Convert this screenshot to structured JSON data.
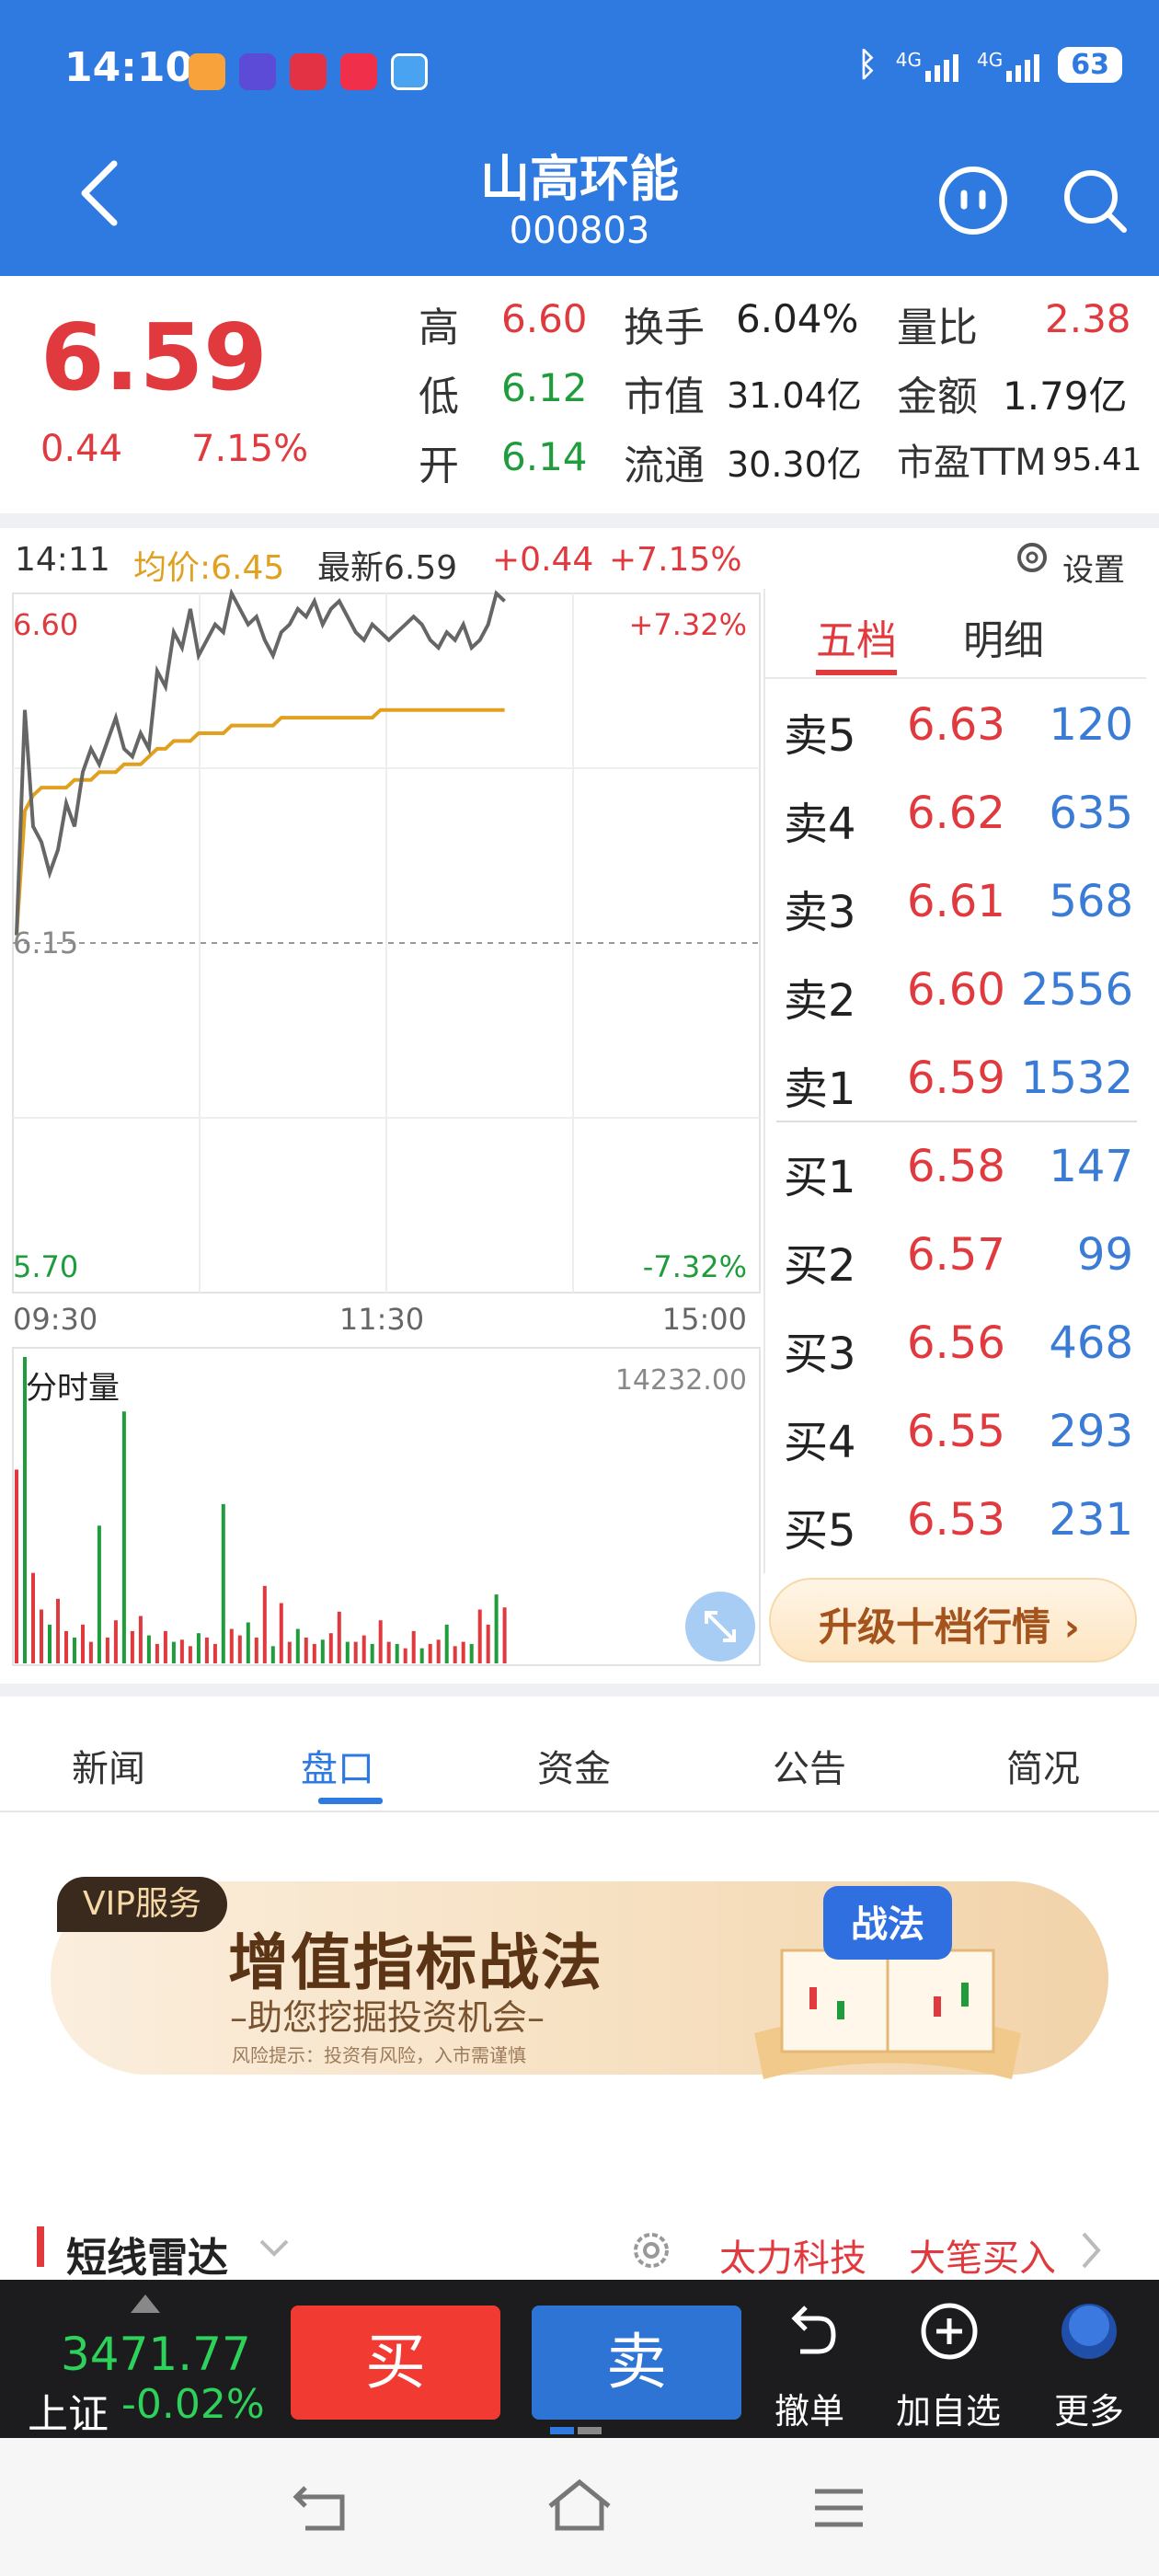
{
  "status_bar": {
    "time": "14:10",
    "network1": "4G",
    "network2": "4G",
    "battery": "63"
  },
  "header": {
    "name": "山高环能",
    "code": "000803"
  },
  "quote": {
    "price": "6.59",
    "change": "0.44",
    "change_pct": "7.15%",
    "high_label": "高",
    "high": "6.60",
    "low_label": "低",
    "low": "6.12",
    "open_label": "开",
    "open": "6.14",
    "turnover_label": "换手",
    "turnover": "6.04%",
    "mktcap_label": "市值",
    "mktcap": "31.04亿",
    "float_label": "流通",
    "float": "30.30亿",
    "volratio_label": "量比",
    "volratio": "2.38",
    "amount_label": "金额",
    "amount": "1.79亿",
    "pe_label": "市盈TTM",
    "pe": "95.41"
  },
  "chart_header": {
    "time": "14:11",
    "avg": "均价:6.45",
    "latest": "最新6.59",
    "chg": "+0.44",
    "pct": "+7.15%",
    "settings": "设置"
  },
  "chart_labels": {
    "top_left": "6.60",
    "top_right": "+7.32%",
    "mid": "6.15",
    "bottom_left": "5.70",
    "bottom_right": "-7.32%",
    "t0": "09:30",
    "t1": "11:30",
    "t2": "15:00",
    "vol_title": "分时量",
    "vol_max": "14232.00"
  },
  "chart_data": {
    "type": "line",
    "ylim": [
      5.7,
      6.6
    ],
    "x_range": [
      "09:30",
      "15:00"
    ],
    "reference": 6.15,
    "series": [
      {
        "name": "price",
        "color": "#666666",
        "values": [
          6.16,
          6.45,
          6.3,
          6.28,
          6.24,
          6.27,
          6.33,
          6.3,
          6.37,
          6.4,
          6.38,
          6.41,
          6.44,
          6.4,
          6.39,
          6.42,
          6.4,
          6.5,
          6.48,
          6.55,
          6.53,
          6.58,
          6.52,
          6.54,
          6.56,
          6.55,
          6.6,
          6.58,
          6.56,
          6.57,
          6.54,
          6.52,
          6.55,
          6.56,
          6.58,
          6.57,
          6.59,
          6.56,
          6.58,
          6.59,
          6.57,
          6.55,
          6.54,
          6.56,
          6.55,
          6.54,
          6.55,
          6.56,
          6.57,
          6.56,
          6.54,
          6.53,
          6.55,
          6.54,
          6.56,
          6.53,
          6.54,
          6.56,
          6.6,
          6.59
        ]
      },
      {
        "name": "avg",
        "color": "#e0a020",
        "values": [
          6.16,
          6.32,
          6.34,
          6.35,
          6.35,
          6.35,
          6.35,
          6.36,
          6.36,
          6.36,
          6.37,
          6.37,
          6.37,
          6.38,
          6.38,
          6.38,
          6.39,
          6.4,
          6.4,
          6.41,
          6.41,
          6.41,
          6.42,
          6.42,
          6.42,
          6.42,
          6.43,
          6.43,
          6.43,
          6.43,
          6.43,
          6.43,
          6.44,
          6.44,
          6.44,
          6.44,
          6.44,
          6.44,
          6.44,
          6.44,
          6.44,
          6.44,
          6.44,
          6.44,
          6.45,
          6.45,
          6.45,
          6.45,
          6.45,
          6.45,
          6.45,
          6.45,
          6.45,
          6.45,
          6.45,
          6.45,
          6.45,
          6.45,
          6.45,
          6.45
        ]
      }
    ],
    "volume_max": 14232.0,
    "volume": [
      9000,
      14232,
      4200,
      2500,
      1800,
      3000,
      1500,
      1200,
      1800,
      1000,
      6400,
      1200,
      2000,
      11700,
      1500,
      2200,
      1300,
      900,
      1500,
      1000,
      1100,
      800,
      1400,
      1200,
      900,
      7400,
      1600,
      1300,
      1900,
      1200,
      3600,
      800,
      2800,
      1000,
      1600,
      1200,
      900,
      1100,
      1400,
      2400,
      1000,
      1000,
      1300,
      900,
      2000,
      1000,
      900,
      700,
      1500,
      700,
      900,
      1100,
      1800,
      800,
      1000,
      900,
      2500,
      1800,
      3200,
      2600
    ]
  },
  "orderbook": {
    "tabs": [
      "五档",
      "明细"
    ],
    "asks": [
      {
        "label": "卖5",
        "price": "6.63",
        "vol": "120"
      },
      {
        "label": "卖4",
        "price": "6.62",
        "vol": "635"
      },
      {
        "label": "卖3",
        "price": "6.61",
        "vol": "568"
      },
      {
        "label": "卖2",
        "price": "6.60",
        "vol": "2556"
      },
      {
        "label": "卖1",
        "price": "6.59",
        "vol": "1532"
      }
    ],
    "bids": [
      {
        "label": "买1",
        "price": "6.58",
        "vol": "147"
      },
      {
        "label": "买2",
        "price": "6.57",
        "vol": "99"
      },
      {
        "label": "买3",
        "price": "6.56",
        "vol": "468"
      },
      {
        "label": "买4",
        "price": "6.55",
        "vol": "293"
      },
      {
        "label": "买5",
        "price": "6.53",
        "vol": "231"
      }
    ],
    "upgrade": "升级十档行情 ›"
  },
  "tabs": [
    "新闻",
    "盘口",
    "资金",
    "公告",
    "简况"
  ],
  "banner": {
    "vip": "VIP服务",
    "title": "增值指标战法",
    "subtitle": "–助您挖掘投资机会–",
    "risk": "风险提示：投资有风险，入市需谨慎",
    "badge": "战法"
  },
  "radar": {
    "title": "短线雷达",
    "stock": "太力科技",
    "signal": "大笔买入"
  },
  "tradebar": {
    "index_value": "3471.77",
    "index_name": "上证",
    "index_pct": "-0.02%",
    "buy": "买",
    "sell": "卖",
    "cancel": "撤单",
    "watch": "加自选",
    "more": "更多"
  },
  "colors": {
    "header_bg": "#2f7ae0",
    "up": "#e0393e",
    "down": "#1f9c3b",
    "buy": "#f13a32",
    "sell": "#2d74d4"
  }
}
